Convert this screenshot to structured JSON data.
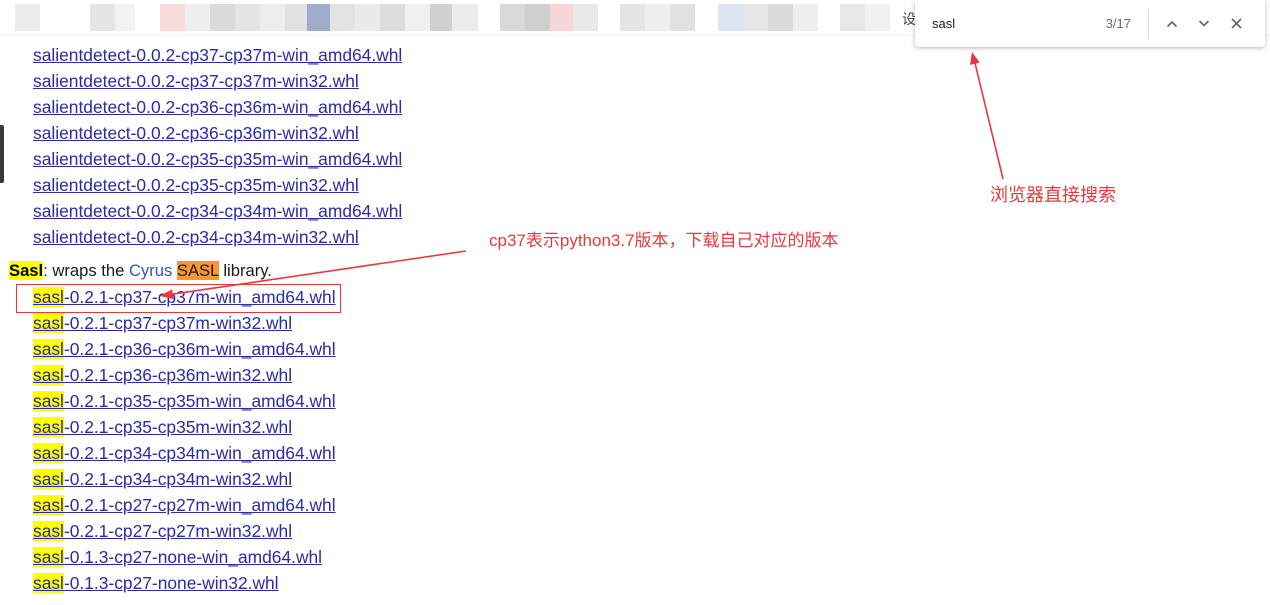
{
  "browser": {
    "bookmark_bar_char": "设",
    "find_bar": {
      "query": "sasl",
      "match_count": "3/17",
      "previous_icon": "chevron-up-icon",
      "next_icon": "chevron-down-icon",
      "close_icon": "close-icon"
    }
  },
  "page": {
    "salientdetect_links": [
      "salientdetect-0.0.2-cp37-cp37m-win_amd64.whl",
      "salientdetect-0.0.2-cp37-cp37m-win32.whl",
      "salientdetect-0.0.2-cp36-cp36m-win_amd64.whl",
      "salientdetect-0.0.2-cp36-cp36m-win32.whl",
      "salientdetect-0.0.2-cp35-cp35m-win_amd64.whl",
      "salientdetect-0.0.2-cp35-cp35m-win32.whl",
      "salientdetect-0.0.2-cp34-cp34m-win_amd64.whl",
      "salientdetect-0.0.2-cp34-cp34m-win32.whl"
    ],
    "sasl_section": {
      "name": "Sasl",
      "text_before_link": ": wraps the",
      "link_text": "Cyrus",
      "matched_term": "SASL",
      "text_after": "library."
    },
    "sasl_links": [
      {
        "match": "sasl",
        "rest": "-0.2.1-cp37-cp37m-win_amd64.whl"
      },
      {
        "match": "sasl",
        "rest": "-0.2.1-cp37-cp37m-win32.whl"
      },
      {
        "match": "sasl",
        "rest": "-0.2.1-cp36-cp36m-win_amd64.whl"
      },
      {
        "match": "sasl",
        "rest": "-0.2.1-cp36-cp36m-win32.whl"
      },
      {
        "match": "sasl",
        "rest": "-0.2.1-cp35-cp35m-win_amd64.whl"
      },
      {
        "match": "sasl",
        "rest": "-0.2.1-cp35-cp35m-win32.whl"
      },
      {
        "match": "sasl",
        "rest": "-0.2.1-cp34-cp34m-win_amd64.whl"
      },
      {
        "match": "sasl",
        "rest": "-0.2.1-cp34-cp34m-win32.whl"
      },
      {
        "match": "sasl",
        "rest": "-0.2.1-cp27-cp27m-win_amd64.whl"
      },
      {
        "match": "sasl",
        "rest": "-0.2.1-cp27-cp27m-win32.whl"
      },
      {
        "match": "sasl",
        "rest": "-0.1.3-cp27-none-win_amd64.whl"
      },
      {
        "match": "sasl",
        "rest": "-0.1.3-cp27-none-win32.whl"
      }
    ]
  },
  "annotations": {
    "find_tip": "浏览器直接搜索",
    "version_tip": "cp37表示python3.7版本，下载自己对应的版本"
  },
  "colors": {
    "link": "#2b2ba8",
    "find_highlight": "#ffff00",
    "find_highlight_active": "#ff9632",
    "annotation": "#e8383d"
  }
}
